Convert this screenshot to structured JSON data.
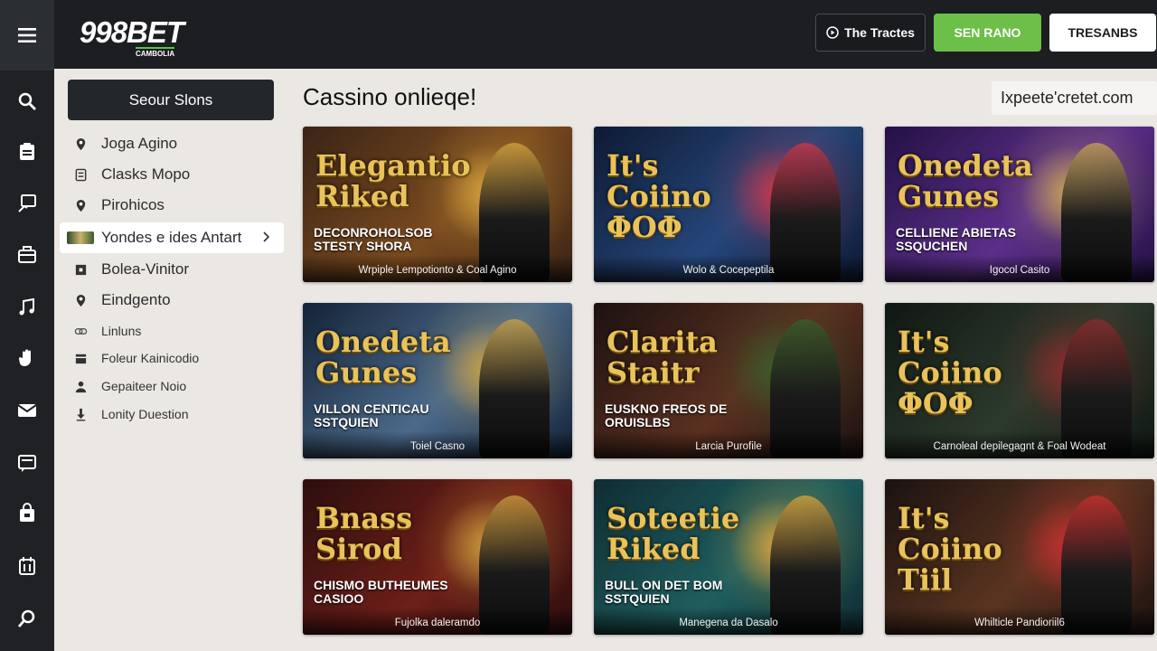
{
  "brand": {
    "logo": "998BET",
    "tagline": "CAMBOLIA"
  },
  "header": {
    "buttons": [
      {
        "label": "The Tractes"
      },
      {
        "label": "SEN RANO"
      },
      {
        "label": "TRESANBS"
      }
    ]
  },
  "sidebar": {
    "search_label": "Seour Slons",
    "items": [
      {
        "label": "Joga Agino",
        "icon": "pin-icon"
      },
      {
        "label": "Clasks Mopo",
        "icon": "card-icon"
      },
      {
        "label": "Pirohicos",
        "icon": "pin-icon"
      },
      {
        "label": "Yondes e ides Antart",
        "icon": "thumbnail-icon"
      },
      {
        "label": "Bolea-Vinitor",
        "icon": "square-icon"
      },
      {
        "label": "Eindgento",
        "icon": "pin-icon"
      },
      {
        "label": "Linluns",
        "icon": "link-icon"
      },
      {
        "label": "Foleur Kainicodio",
        "icon": "box-icon"
      },
      {
        "label": "Gepaiteer Noio",
        "icon": "user-icon"
      },
      {
        "label": "Lonity Duestion",
        "icon": "download-icon"
      }
    ]
  },
  "main": {
    "title": "Cassino onlieqe!",
    "title_link": "Ixpeete'cretet.com",
    "cards": [
      {
        "heading": "Elegantio Riked",
        "subheading": "DECONROHOLSOB STESTY SHORA",
        "caption": "Wrpiple Lempotionto & Coal Agino",
        "palette": [
          "#3a2416",
          "#7a4a1e",
          "#d4a23e"
        ]
      },
      {
        "heading": "It's Coiino ΦOΦ",
        "subheading": "",
        "caption": "Wolo & Cocepeptila",
        "palette": [
          "#0e1a33",
          "#25467a",
          "#c9374a"
        ]
      },
      {
        "heading": "Onedeta Gunes",
        "subheading": "CELLIENE ABIETAS SSQUCHEN",
        "caption": "Igocol Casito",
        "palette": [
          "#241145",
          "#5c2f8a",
          "#c4a25a"
        ]
      },
      {
        "heading": "Onedeta Gunes",
        "subheading": "VILLON CENTICAU SSTQUIEN",
        "caption": "Toiel Casno",
        "palette": [
          "#142338",
          "#4b6a8a",
          "#c8a04a"
        ]
      },
      {
        "heading": "Clarita Staitr",
        "subheading": "EUSKNO FREOS DE ORUISLBS",
        "caption": "Larcia Purofile",
        "palette": [
          "#1c1210",
          "#5b3020",
          "#3a5c2a"
        ]
      },
      {
        "heading": "It's Coiino ΦOΦ",
        "subheading": "",
        "caption": "Carnoleal depilegagnt & Foal Wodeat",
        "palette": [
          "#101713",
          "#2c3a2c",
          "#8a2c2c"
        ]
      },
      {
        "heading": "Bnass Sirod",
        "subheading": "CHISMO BUTHEUMES CASIOO",
        "caption": "Fujolka daleramdo",
        "palette": [
          "#2c0e0e",
          "#6e1f18",
          "#c99a3c"
        ]
      },
      {
        "heading": "Soteetie Riked",
        "subheading": "BULL ON DET BOM SSTQUIEN",
        "caption": "Manegena da Dasalo",
        "palette": [
          "#0f2c33",
          "#1f5e5e",
          "#d4a23e"
        ]
      },
      {
        "heading": "It's Coiino Tiil",
        "subheading": "",
        "caption": "Whilticle Pandioriil6",
        "palette": [
          "#1b1210",
          "#5a3420",
          "#c43030"
        ]
      }
    ]
  },
  "rail": {
    "icons": [
      "menu-icon",
      "search-icon",
      "document-icon",
      "monitor-icon",
      "briefcase-icon",
      "music-icon",
      "hand-icon",
      "mail-icon",
      "chat-icon",
      "bag-icon",
      "calendar-icon",
      "search-icon"
    ]
  }
}
